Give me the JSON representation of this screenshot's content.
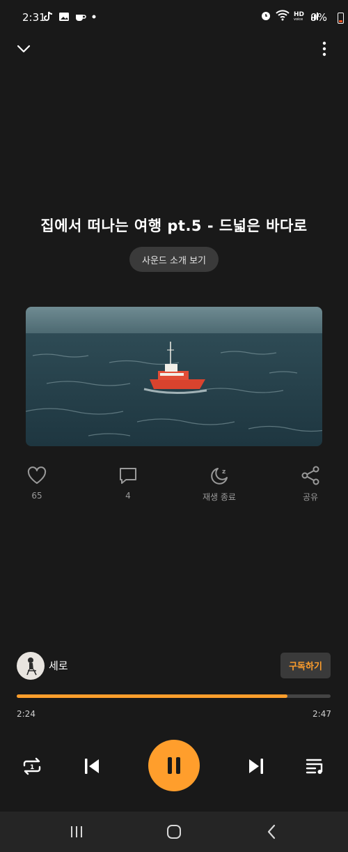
{
  "status_bar": {
    "time": "2:31",
    "battery": "9%",
    "left_icons": [
      "tiktok-icon",
      "image-icon",
      "coffee-icon",
      "dot-icon"
    ],
    "right_icons": [
      "alarm-icon",
      "wifi-icon",
      "hd-voice-icon",
      "signal-icon"
    ]
  },
  "header": {
    "collapse_icon": "chevron-down-icon",
    "more_icon": "more-vertical-icon"
  },
  "track": {
    "title": "집에서 떠나는 여행 pt.5 - 드넓은 바다로",
    "intro_button": "사운드 소개 보기"
  },
  "actions": [
    {
      "icon": "heart-icon",
      "label": "65"
    },
    {
      "icon": "comment-icon",
      "label": "4"
    },
    {
      "icon": "sleep-timer-icon",
      "label": "재생 종료"
    },
    {
      "icon": "share-icon",
      "label": "공유"
    }
  ],
  "author": {
    "name": "세로",
    "subscribe_label": "구독하기"
  },
  "playback": {
    "current_time": "2:24",
    "total_time": "2:47",
    "progress": 0.862
  },
  "controls": [
    "repeat-icon",
    "skip-previous-icon",
    "pause-icon",
    "skip-next-icon",
    "playlist-icon"
  ],
  "colors": {
    "background": "#191919",
    "accent": "#ff9e2c",
    "button_bg": "#3a3a3a"
  }
}
